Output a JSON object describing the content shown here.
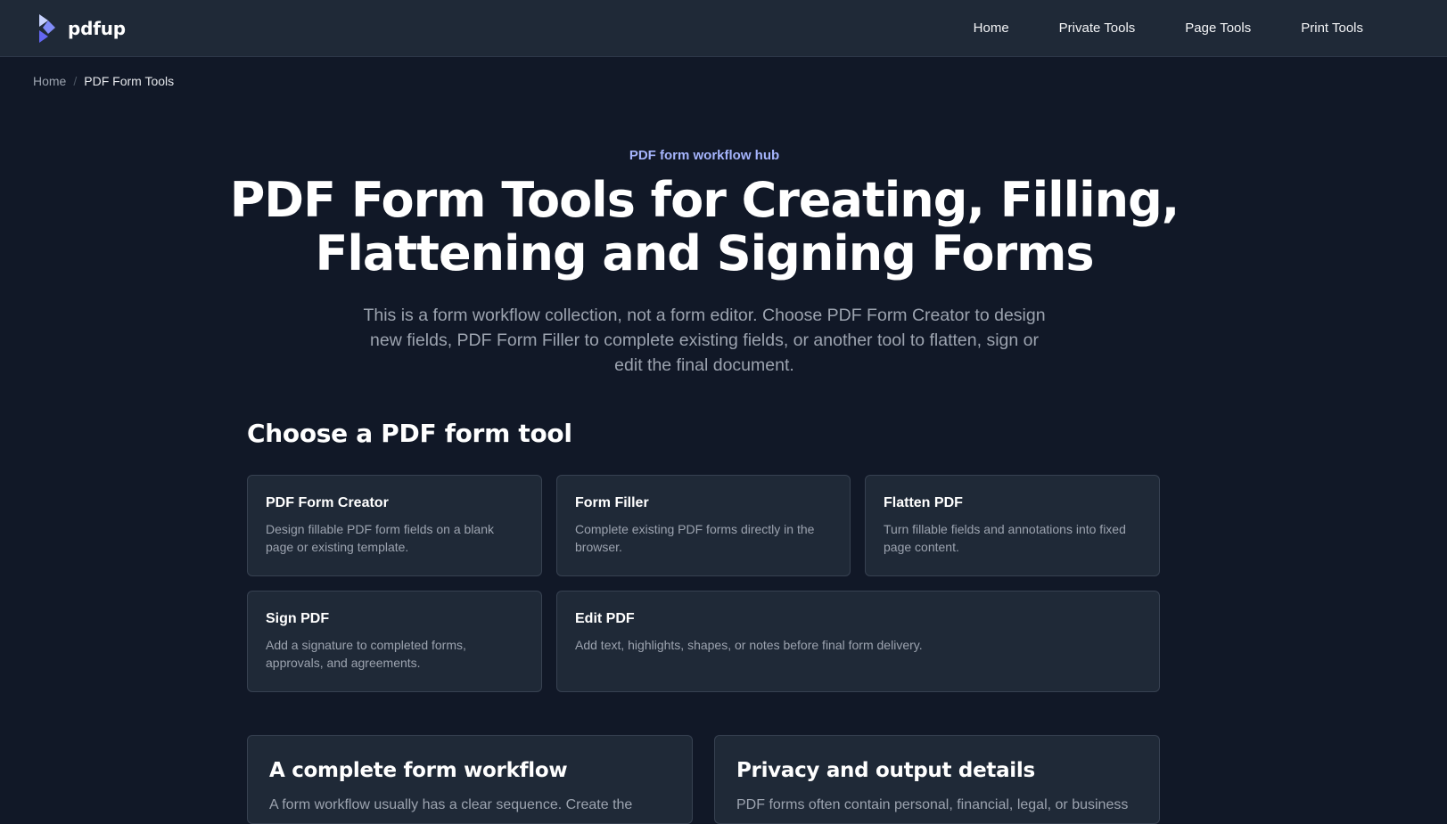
{
  "brand": {
    "name": "pdfup",
    "accent": "#818cf8",
    "accent_dark": "#4f46e5"
  },
  "nav": {
    "items": [
      {
        "label": "Home"
      },
      {
        "label": "Private Tools"
      },
      {
        "label": "Page Tools"
      },
      {
        "label": "Print Tools"
      }
    ]
  },
  "breadcrumb": {
    "home": "Home",
    "separator": "/",
    "current": "PDF Form Tools"
  },
  "hero": {
    "eyebrow": "PDF form workflow hub",
    "title": "PDF Form Tools for Creating, Filling, Flattening and Signing Forms",
    "subtitle": "This is a form workflow collection, not a form editor. Choose PDF Form Creator to design new fields, PDF Form Filler to complete existing fields, or another tool to flatten, sign or edit the final document."
  },
  "tools_section": {
    "title": "Choose a PDF form tool",
    "cards": [
      {
        "title": "PDF Form Creator",
        "desc": "Design fillable PDF form fields on a blank page or existing template."
      },
      {
        "title": "Form Filler",
        "desc": "Complete existing PDF forms directly in the browser."
      },
      {
        "title": "Flatten PDF",
        "desc": "Turn fillable fields and annotations into fixed page content."
      },
      {
        "title": "Sign PDF",
        "desc": "Add a signature to completed forms, approvals, and agreements."
      },
      {
        "title": "Edit PDF",
        "desc": "Add text, highlights, shapes, or notes before final form delivery."
      }
    ]
  },
  "info_panels": [
    {
      "title": "A complete form workflow",
      "text": "A form workflow usually has a clear sequence. Create the"
    },
    {
      "title": "Privacy and output details",
      "text": "PDF forms often contain personal, financial, legal, or business"
    }
  ],
  "colors": {
    "background": "#111827",
    "surface": "#1f2937",
    "border": "#374151",
    "eyebrow": "#a5b4fc",
    "muted_text": "#9ca3af"
  }
}
